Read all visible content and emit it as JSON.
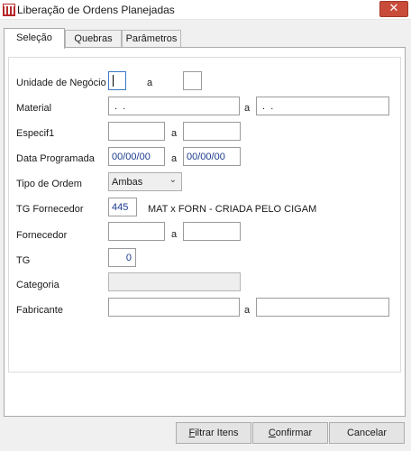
{
  "window": {
    "title": "Liberação de Ordens Planejadas",
    "close_glyph": "✕",
    "app_icon": "app-logo-icon"
  },
  "tabs": [
    {
      "label": "Seleção",
      "active": true
    },
    {
      "label": "Quebras",
      "active": false
    },
    {
      "label": "Parâmetros",
      "active": false
    }
  ],
  "form": {
    "range_sep": "a",
    "unidade": {
      "label": "Unidade de Negócio",
      "from": "",
      "to": ""
    },
    "material": {
      "label": "Material",
      "from": " .  .",
      "to": " .  ."
    },
    "especif1": {
      "label": "Especif1",
      "from": "",
      "to": ""
    },
    "data_programada": {
      "label": "Data Programada",
      "from": "00/00/00",
      "to": "00/00/00"
    },
    "tipo_ordem": {
      "label": "Tipo de Ordem",
      "value": "Ambas",
      "chevron": "⌄"
    },
    "tg_fornecedor": {
      "label": "TG Fornecedor",
      "value": "445",
      "description": "MAT x FORN - CRIADA PELO CIGAM"
    },
    "fornecedor": {
      "label": "Fornecedor",
      "from": "",
      "to": ""
    },
    "tg": {
      "label": "TG",
      "value": "0"
    },
    "categoria": {
      "label": "Categoria",
      "value": ""
    },
    "fabricante": {
      "label": "Fabricante",
      "from": "",
      "to": ""
    }
  },
  "buttons": {
    "filtrar": {
      "hot": "F",
      "rest": "iltrar Itens"
    },
    "confirmar": {
      "hot": "C",
      "rest": "onfirmar"
    },
    "cancelar": {
      "hot": "",
      "rest": "Cancelar"
    }
  },
  "colors": {
    "accent": "#c94c3a",
    "field_text": "#1a3a8c"
  }
}
